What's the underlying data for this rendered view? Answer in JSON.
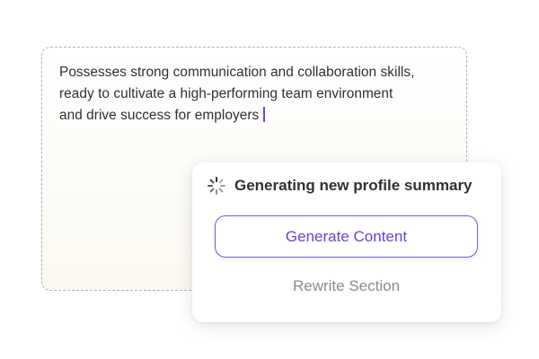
{
  "editor": {
    "text": "Possesses strong communication and collaboration skills, ready to cultivate a high-performing team environment and drive success for employers"
  },
  "popup": {
    "status_icon": "spinner-icon",
    "status_text": "Generating new profile summary",
    "generate_label": "Generate Content",
    "rewrite_label": "Rewrite Section"
  },
  "colors": {
    "accent": "#7c52e6",
    "accent_text": "#6a3fd9",
    "muted_text": "#8a8a90",
    "body_text": "#2f2f33",
    "dashed_border": "#b6b3b0"
  }
}
